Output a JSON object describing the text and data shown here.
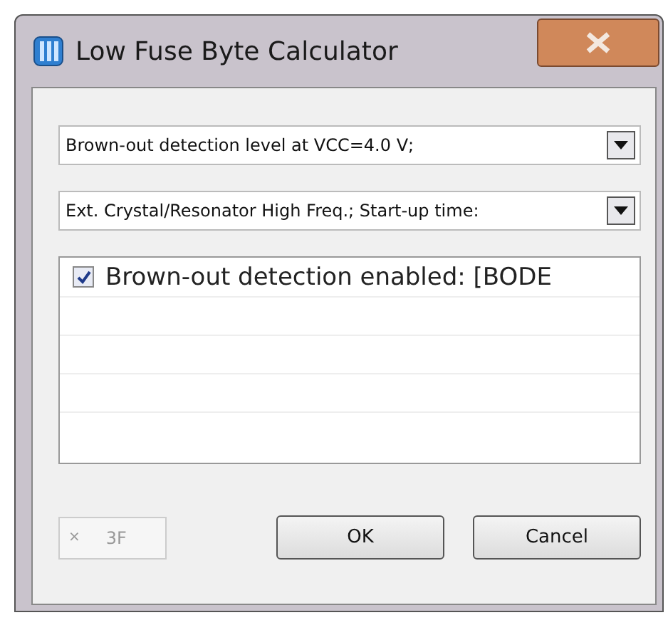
{
  "window": {
    "title": "Low Fuse Byte Calculator"
  },
  "dropdowns": [
    {
      "value": "Brown-out detection level at VCC=4.0 V;"
    },
    {
      "value": "Ext. Crystal/Resonator High Freq.; Start-up time:"
    }
  ],
  "options": [
    {
      "label": "Brown-out detection enabled: [BODE",
      "checked": true
    }
  ],
  "value_field": {
    "prefix": "×",
    "value": "3F",
    "disabled": true
  },
  "buttons": [
    "OK",
    "Cancel"
  ]
}
